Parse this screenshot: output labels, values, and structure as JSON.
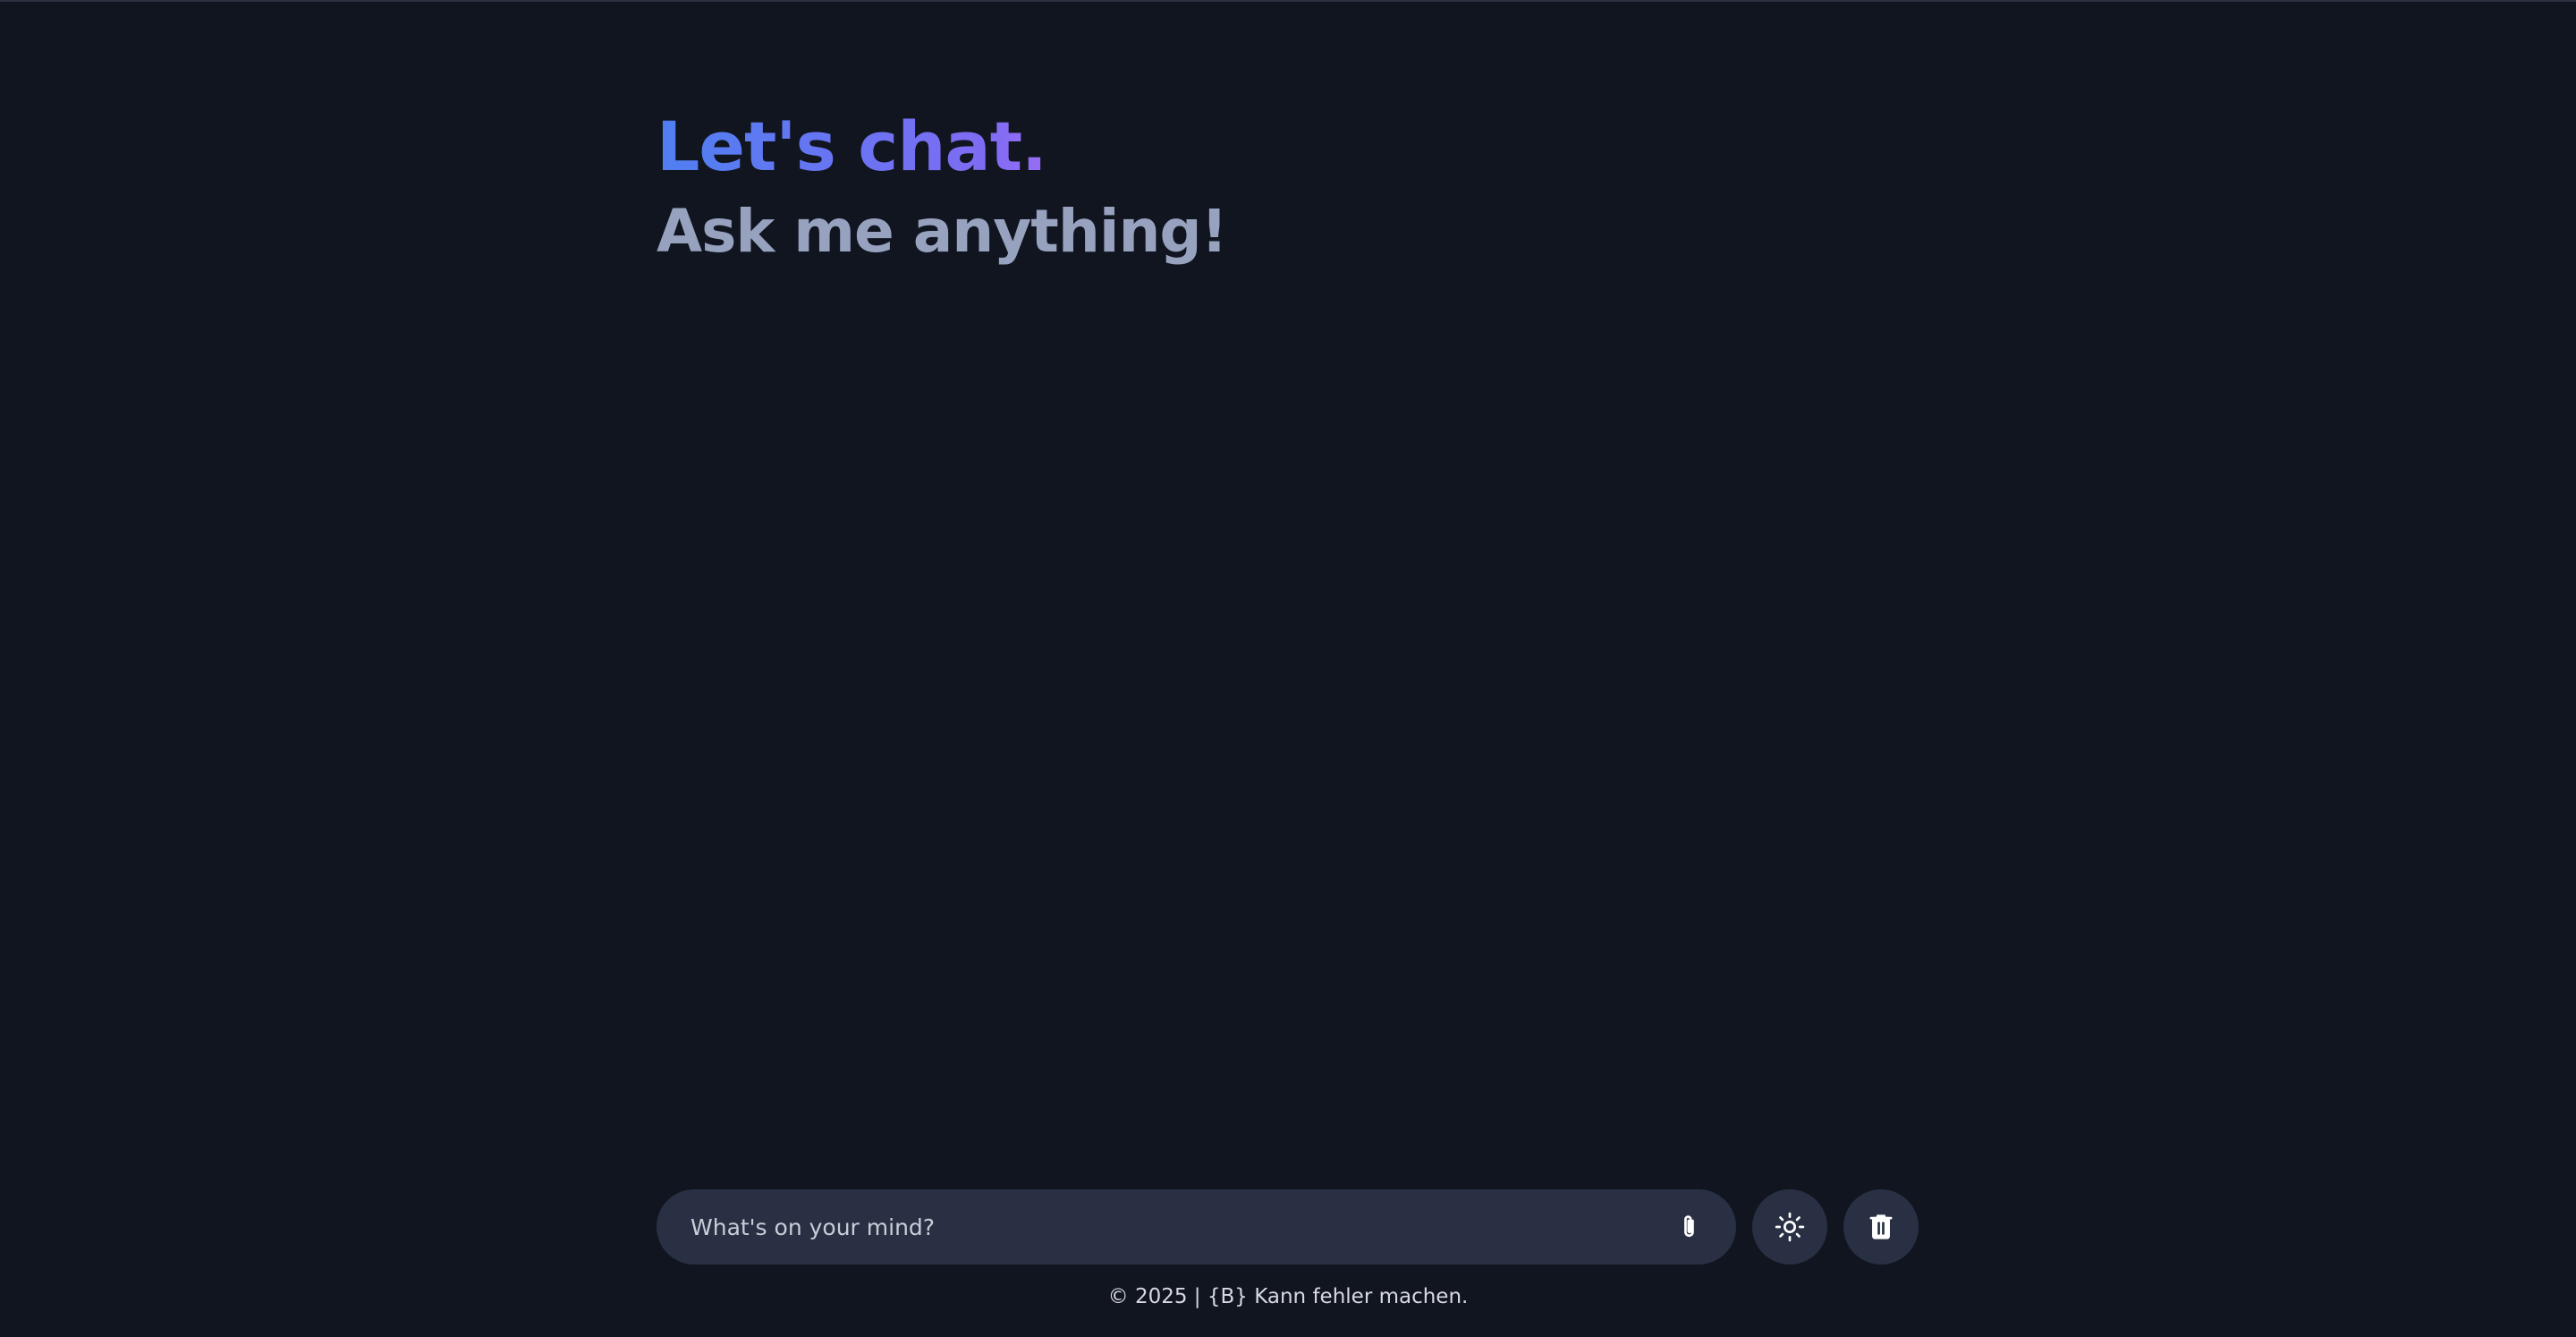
{
  "header": {
    "greeting": "Let's chat.",
    "subheading": "Ask me anything!"
  },
  "composer": {
    "placeholder": "What's on your mind?",
    "value": ""
  },
  "icons": {
    "attach": "paperclip-icon",
    "theme": "sun-icon",
    "delete": "trash-icon"
  },
  "footer": {
    "text": "© 2025 | {B} Kann fehler machen."
  },
  "colors": {
    "background": "#111520",
    "surface": "#293043",
    "accent_start": "#4f7ff1",
    "accent_end": "#9a6cf5",
    "subheading": "#97a2bf"
  }
}
